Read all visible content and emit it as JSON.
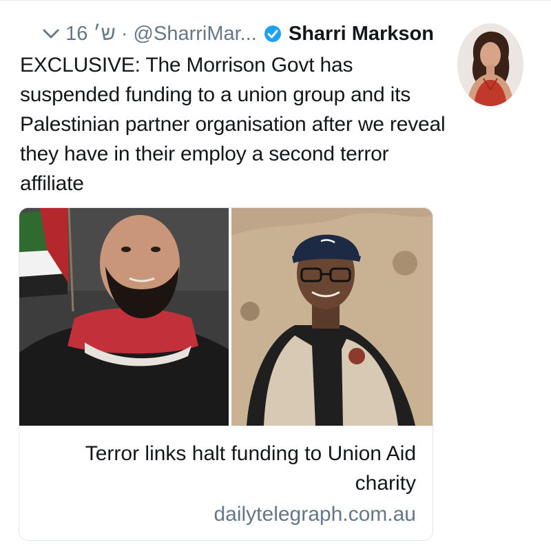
{
  "tweet": {
    "author_name": "Sharri Markson",
    "handle": "@SharriMar...",
    "separator": "·",
    "date": "16 ש׳",
    "verified": true,
    "text": "EXCLUSIVE: The Morrison Govt has suspended funding to a union group and its Palestinian partner organisation after we reveal they have in their employ a second terror affiliate"
  },
  "card": {
    "title": "Terror links halt funding to Union Aid charity",
    "domain": "dailytelegraph.com.au"
  },
  "icons": {
    "verified": "verified-badge-icon",
    "chevron": "chevron-down-icon"
  },
  "colors": {
    "text": "#14171a",
    "secondary": "#657786",
    "verified": "#1da1f2",
    "border": "#e1e8ed"
  }
}
